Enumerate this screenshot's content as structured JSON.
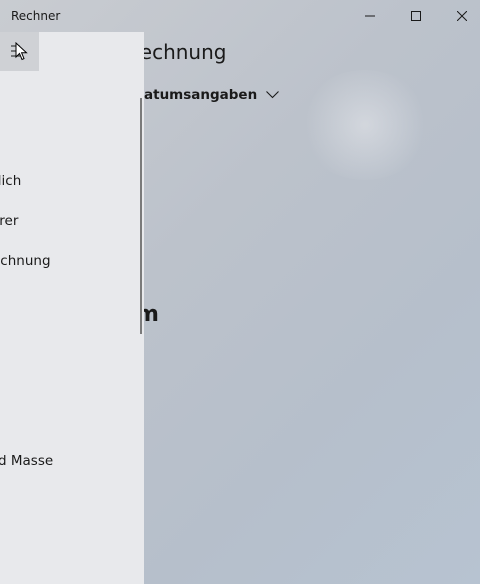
{
  "window": {
    "title": "Rechner",
    "controls": {
      "minimize_icon": "minimize-icon",
      "maximize_icon": "maximize-icon",
      "close_icon": "close-icon"
    }
  },
  "main": {
    "title": "rechnung",
    "mode_selector": {
      "label": "atumsangaben",
      "icon": "chevron-down-icon"
    },
    "result_fragment": "m"
  },
  "nav": {
    "menu_icon": "hamburger-menu-icon",
    "items": [
      {
        "label": "ftlich"
      },
      {
        "label": "erer"
      },
      {
        "label": "echnung"
      },
      {
        "label": "d Masse"
      }
    ]
  },
  "colors": {
    "nav_background": "#e8e9ec",
    "hamburger_background": "#cfd1d5",
    "text": "#1a1a1a",
    "backdrop": "#bcc2cb"
  }
}
